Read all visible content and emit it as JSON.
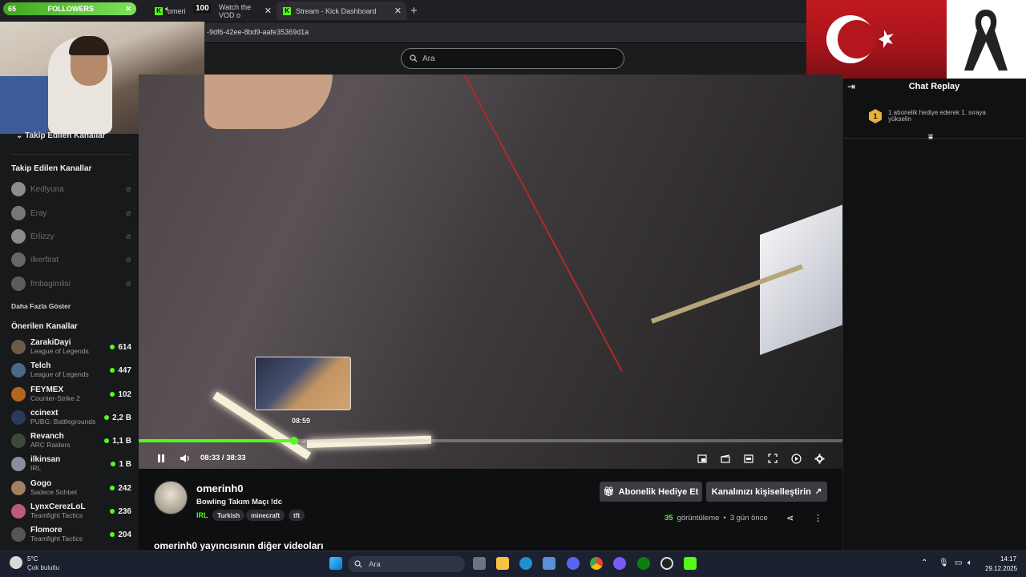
{
  "browser": {
    "tabs": [
      {
        "label": "omeri",
        "active": false
      },
      {
        "label": "Watch the VOD o",
        "active": false
      },
      {
        "label": "Stream - Kick Dashboard",
        "active": true
      }
    ],
    "url": "-9df6-42ee-8bd9-aafe35369d1a"
  },
  "overlay": {
    "followers_count": "65",
    "followers_label": "FOLLOWERS",
    "volume": "100"
  },
  "header": {
    "search_placeholder": "Ara"
  },
  "sidebar": {
    "collapsed_section": "Takip Edilen Kanallar",
    "followed_heading": "Takip Edilen Kanallar",
    "followed": [
      {
        "name": "Kedlyuna"
      },
      {
        "name": "Eray"
      },
      {
        "name": "Erlizzy"
      },
      {
        "name": "ilkerfirat"
      },
      {
        "name": "fmbagimlisi"
      }
    ],
    "show_more": "Daha Fazla Göster",
    "recommended_heading": "Önerilen Kanallar",
    "recommended": [
      {
        "name": "ZarakiDayi",
        "category": "League of Legends",
        "viewers": "614"
      },
      {
        "name": "Telch",
        "category": "League of Legends",
        "viewers": "447"
      },
      {
        "name": "FEYMEX",
        "category": "Counter-Strike 2",
        "viewers": "102"
      },
      {
        "name": "ccinext",
        "category": "PUBG: Battlegrounds",
        "viewers": "2,2 B"
      },
      {
        "name": "Revanch",
        "category": "ARC Raiders",
        "viewers": "1,1 B"
      },
      {
        "name": "ilkinsan",
        "category": "IRL",
        "viewers": "1 B"
      },
      {
        "name": "Gogo",
        "category": "Sadece Sohbet",
        "viewers": "242"
      },
      {
        "name": "LynxCerezLoL",
        "category": "Teamfight Tactics",
        "viewers": "236"
      },
      {
        "name": "Flomore",
        "category": "Teamfight Tactics",
        "viewers": "204"
      }
    ]
  },
  "player": {
    "preview_time": "08:59",
    "current_time": "08:33",
    "duration": "38:33",
    "timecode": "08:33 / 38:33",
    "progress_fraction": 0.2213,
    "hover_fraction": 0.2335
  },
  "channel": {
    "name": "omerinh0",
    "title": "Bowling Takım Maçı !dc",
    "category": "IRL",
    "tags": [
      "Turkish",
      "minecraft",
      "tft"
    ],
    "gift_button": "Abonelik Hediye Et",
    "customize_button": "Kanalınızı kişiselleştirin",
    "views_count": "35",
    "views_label": "görüntüleme",
    "separator": "•",
    "ago": "3 gün önce",
    "other_videos": "omerinh0 yayıncısının diğer videoları"
  },
  "chat": {
    "title": "Chat Replay",
    "badge": "1",
    "message": "1 abonelik hediye ederek 1. sıraya yükselin"
  },
  "taskbar": {
    "temperature": "5°C",
    "weather": "Çok bulutlu",
    "search": "Ara",
    "time": "14:17",
    "date": "29.12.2025"
  },
  "colors": {
    "kick_green": "#53fc18",
    "background": "#0b0c0d"
  }
}
